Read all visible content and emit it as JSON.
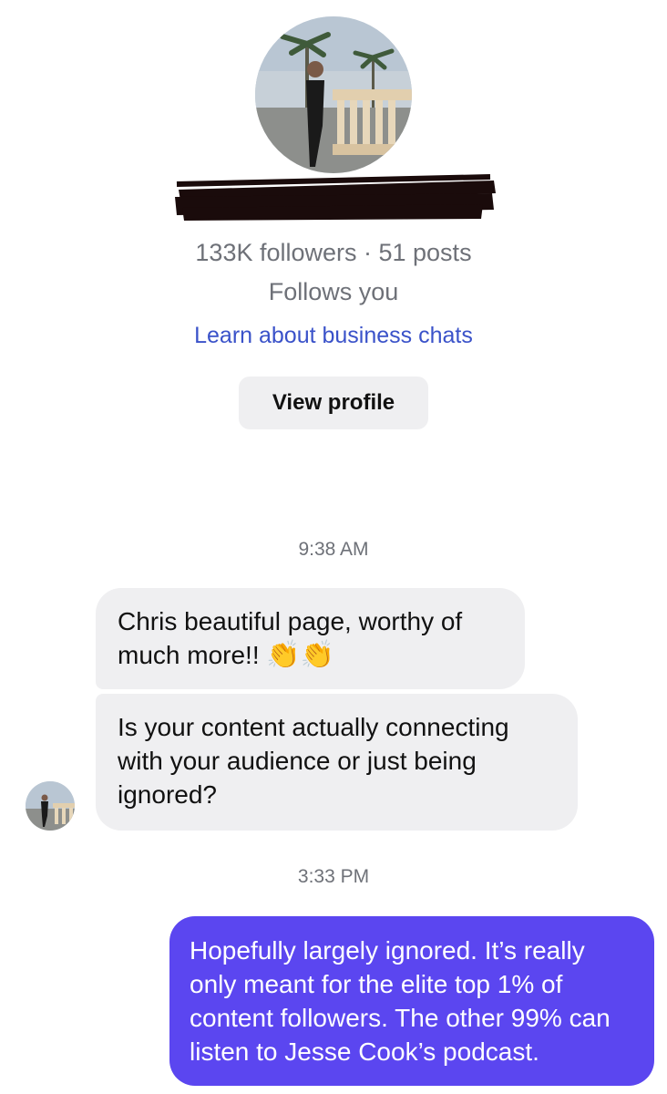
{
  "profile": {
    "stats": "133K followers · 51 posts",
    "follows_status": "Follows you",
    "learn_link": "Learn about business chats",
    "view_profile_label": "View profile"
  },
  "conversation": {
    "timestamp_1": "9:38 AM",
    "timestamp_2": "3:33 PM",
    "incoming": [
      {
        "line1": "Chris beautiful page, worthy of",
        "line2": "much more!!",
        "emoji": "👏👏"
      },
      {
        "text": "Is your content actually connecting with your audience or just being ignored?"
      }
    ],
    "outgoing": [
      {
        "text": "Hopefully largely ignored. It’s really only meant for the elite top 1% of content followers. The other 99% can listen to Jesse Cook’s podcast."
      }
    ]
  },
  "colors": {
    "accent_link": "#3a52c9",
    "outgoing_bubble": "#5b46f0",
    "incoming_bubble": "#efeff1"
  }
}
